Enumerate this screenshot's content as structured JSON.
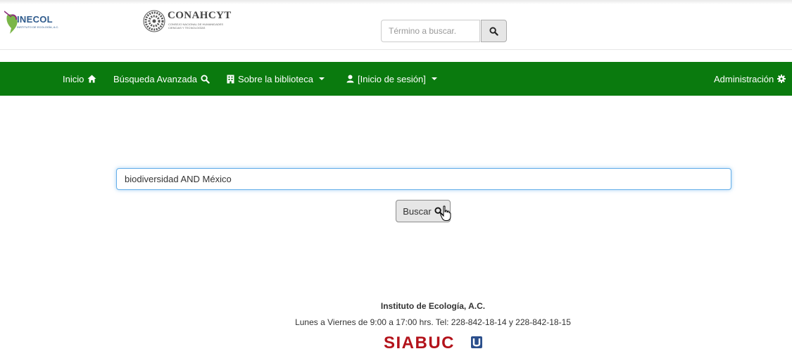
{
  "header": {
    "inecol_logo_text": "INECOL",
    "inecol_logo_subtext": "INSTITUTO DE ECOLOGÍA, A.C.",
    "conahcyt_logo_text": "CONAHCYT",
    "conahcyt_logo_subtext": "CONSEJO NACIONAL DE HUMANIDADES CIENCIAS Y TECNOLOGÍAS",
    "search_placeholder": "Término a buscar.",
    "search_button_icon": "search-icon"
  },
  "navbar": {
    "background_color": "#0a7a0e",
    "items": [
      {
        "label": "Inicio",
        "icon": "home-icon"
      },
      {
        "label": "Búsqueda Avanzada",
        "icon": "search-icon"
      },
      {
        "label": "Sobre la biblioteca",
        "icon": "building-icon"
      },
      {
        "label": "[Inicio de sesión]",
        "icon": "user-icon"
      },
      {
        "label": "Administración",
        "icon": "gear-icon"
      }
    ]
  },
  "main": {
    "search_value": "biodiversidad AND México",
    "search_button_label": "Buscar",
    "search_button_icon": "search-icon"
  },
  "footer": {
    "institution": "Instituto de Ecología, A.C.",
    "hours": "Lunes a Viernes de 9:00 a 17:00 hrs. Tel: 228-842-18-14 y 228-842-18-15",
    "siabuc_logo_text": "SIABUC"
  }
}
